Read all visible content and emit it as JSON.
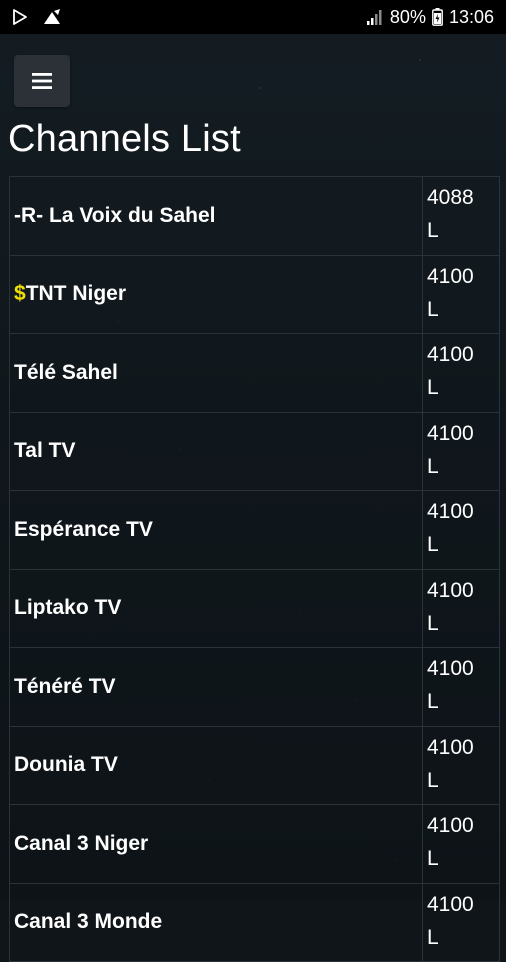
{
  "status_bar": {
    "battery_percent": "80%",
    "time": "13:06",
    "icons": [
      "play-store-icon",
      "app-notification-icon",
      "signal-icon",
      "battery-icon"
    ]
  },
  "header": {
    "menu_icon": "hamburger-menu-icon",
    "title": "Channels List"
  },
  "channels": [
    {
      "prefix": "",
      "name": "-R- La Voix du Sahel",
      "freq": "4088",
      "pol": "L"
    },
    {
      "prefix": "$",
      "name": "TNT Niger",
      "freq": "4100",
      "pol": "L"
    },
    {
      "prefix": "",
      "name": "Télé Sahel",
      "freq": "4100",
      "pol": "L"
    },
    {
      "prefix": "",
      "name": "Tal TV",
      "freq": "4100",
      "pol": "L"
    },
    {
      "prefix": "",
      "name": "Espérance TV",
      "freq": "4100",
      "pol": "L"
    },
    {
      "prefix": "",
      "name": "Liptako TV",
      "freq": "4100",
      "pol": "L"
    },
    {
      "prefix": "",
      "name": "Ténéré TV",
      "freq": "4100",
      "pol": "L"
    },
    {
      "prefix": "",
      "name": "Dounia TV",
      "freq": "4100",
      "pol": "L"
    },
    {
      "prefix": "",
      "name": "Canal 3 Niger",
      "freq": "4100",
      "pol": "L"
    },
    {
      "prefix": "",
      "name": "Canal 3 Monde",
      "freq": "4100",
      "pol": "L"
    }
  ],
  "colors": {
    "background": "#10171c",
    "status_bar": "#000000",
    "menu_button": "#2b3136",
    "table_border": "#2c3338",
    "paid_marker": "#f2e100",
    "text": "#ffffff"
  }
}
